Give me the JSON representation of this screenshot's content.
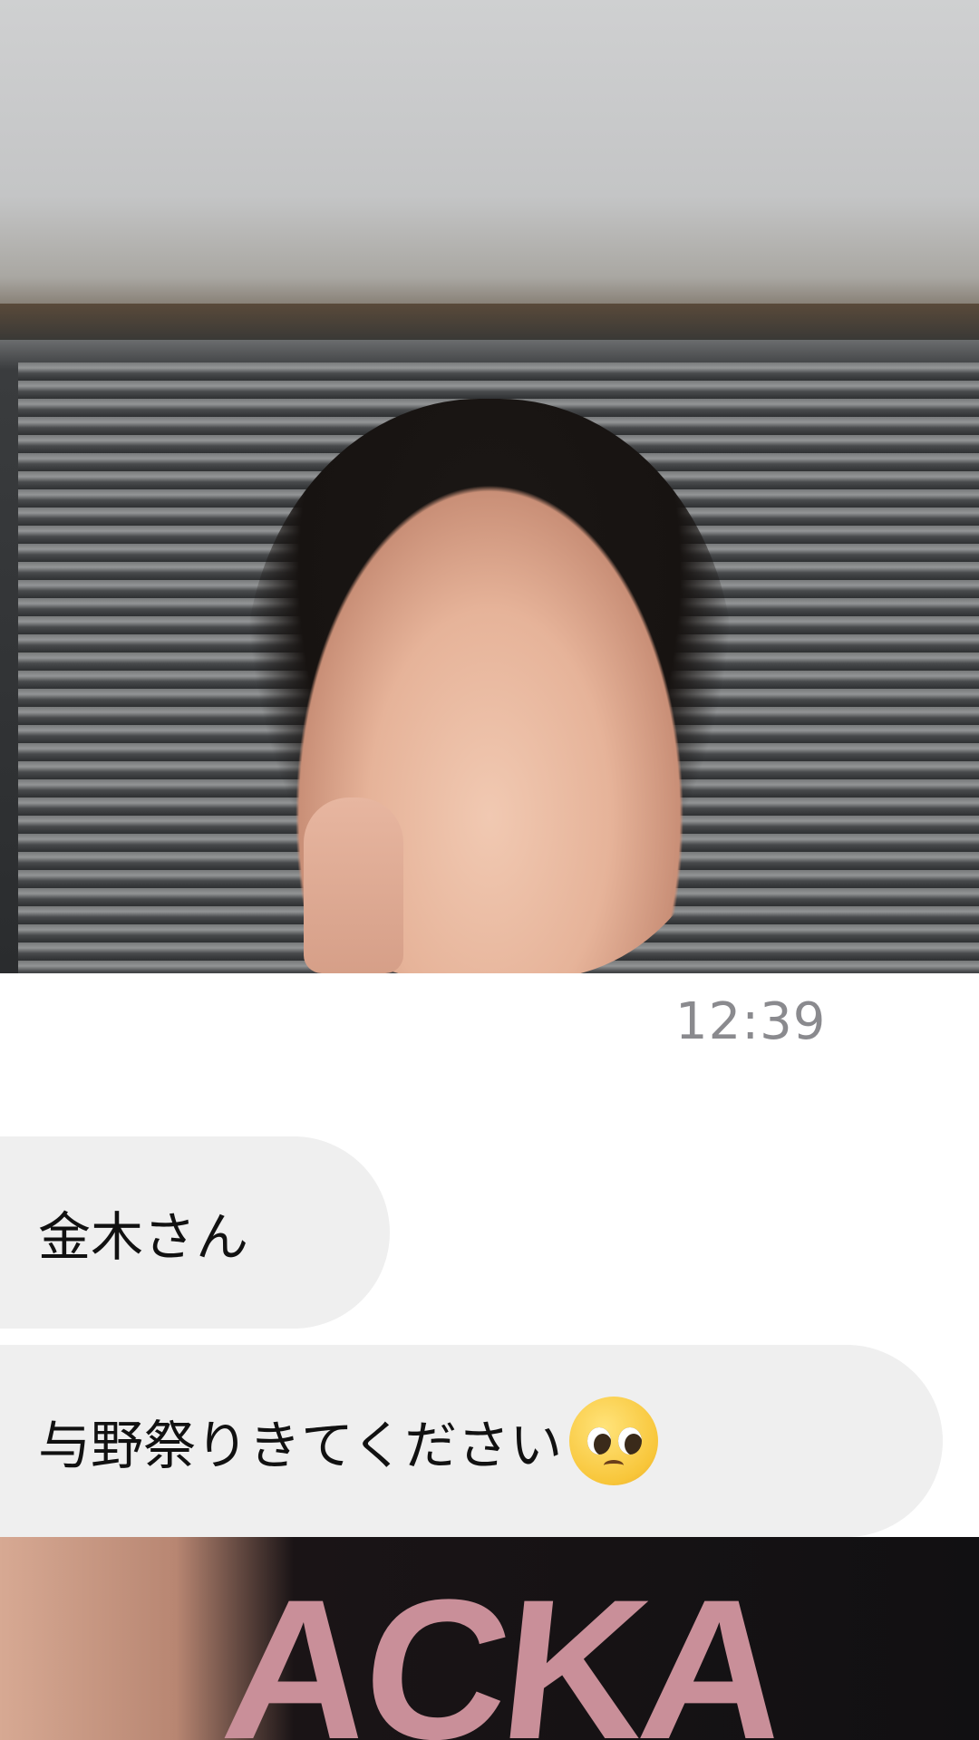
{
  "chat": {
    "timestamp": "12:39",
    "messages": [
      {
        "text": "金木さん"
      },
      {
        "text": "与野祭りきてください",
        "emoji": "pleading-face-emoji"
      }
    ]
  },
  "photos": {
    "top": {
      "icon": "photo"
    },
    "bottom": {
      "shirt_text": "ACKA"
    }
  }
}
